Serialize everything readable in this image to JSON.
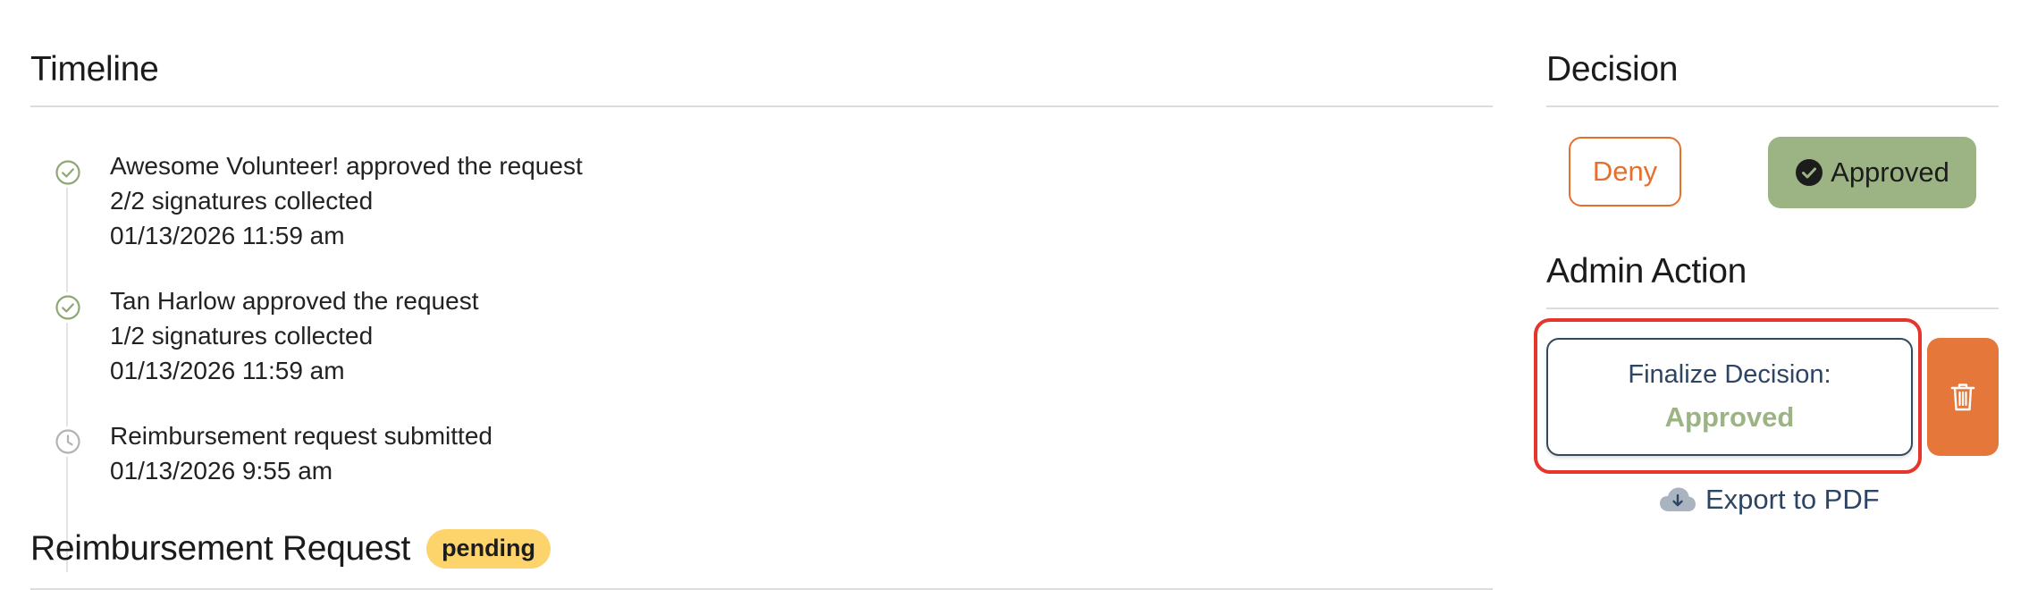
{
  "timeline": {
    "title": "Timeline",
    "events": [
      {
        "icon": "check-circle-icon",
        "lines": [
          "Awesome Volunteer! approved the request",
          "2/2 signatures collected",
          "01/13/2026 11:59 am"
        ]
      },
      {
        "icon": "check-circle-icon",
        "lines": [
          "Tan Harlow approved the request",
          "1/2 signatures collected",
          "01/13/2026 11:59 am"
        ]
      },
      {
        "icon": "clock-icon",
        "lines": [
          "Reimbursement request submitted",
          "01/13/2026 9:55 am"
        ]
      }
    ]
  },
  "reimbursement": {
    "title": "Reimbursement Request",
    "status_badge": "pending"
  },
  "decision": {
    "title": "Decision",
    "deny_label": "Deny",
    "approved_label": "Approved"
  },
  "admin_action": {
    "title": "Admin Action",
    "finalize_label": "Finalize Decision:",
    "finalize_value": "Approved",
    "delete_icon": "trash-icon",
    "export_label": "Export to PDF",
    "export_icon": "cloud-download-icon"
  },
  "colors": {
    "accent_orange": "#e56f2c",
    "approved_green": "#9cb384",
    "navy": "#2d4463",
    "badge_yellow": "#fdd36b",
    "highlight_red": "#e5352d",
    "timeline_check": "#8fa873",
    "timeline_clock": "#b3b3b3"
  }
}
